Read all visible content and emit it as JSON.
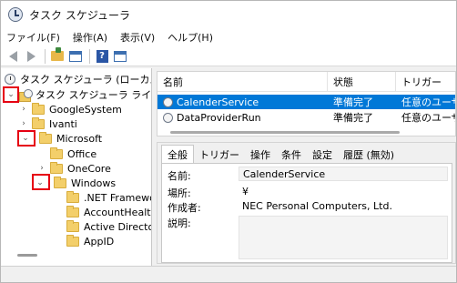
{
  "window": {
    "title": "タスク スケジューラ",
    "icon": "clock-icon"
  },
  "menu": {
    "items": [
      "ファイル(F)",
      "操作(A)",
      "表示(V)",
      "ヘルプ(H)"
    ]
  },
  "toolbar": {
    "icons": [
      "back-arrow-icon",
      "forward-arrow-icon",
      "folder-up-icon",
      "show-hide-tree-icon",
      "help-icon",
      "properties-icon"
    ]
  },
  "tree": {
    "root": "タスク スケジューラ (ローカル)",
    "library": "タスク スケジューラ ライブラリ",
    "items": [
      {
        "label": "GoogleSystem",
        "expanded": false
      },
      {
        "label": "Ivanti",
        "expanded": false
      },
      {
        "label": "Microsoft",
        "expanded": true
      },
      {
        "label": "Office",
        "expanded": false
      },
      {
        "label": "OneCore",
        "expanded": false
      },
      {
        "label": "Windows",
        "expanded": true
      },
      {
        "label": ".NET Framework",
        "expanded": false
      },
      {
        "label": "AccountHealth",
        "expanded": false
      },
      {
        "label": "Active Directory",
        "expanded": false
      },
      {
        "label": "AppID",
        "expanded": false
      }
    ],
    "highlight_color": "#e60012"
  },
  "task_list": {
    "columns": [
      "名前",
      "状態",
      "トリガー"
    ],
    "rows": [
      {
        "name": "CalenderService",
        "status": "準備完了",
        "trigger": "任意のユーザー",
        "selected": true
      },
      {
        "name": "DataProviderRun",
        "status": "準備完了",
        "trigger": "任意のユーザー",
        "selected": false
      }
    ],
    "selection_color": "#0078d7"
  },
  "detail": {
    "tabs": [
      "全般",
      "トリガー",
      "操作",
      "条件",
      "設定",
      "履歴 (無効)"
    ],
    "active_tab": "全般",
    "fields": {
      "name_label": "名前:",
      "name_value": "CalenderService",
      "location_label": "場所:",
      "location_value": "¥",
      "author_label": "作成者:",
      "author_value": "NEC Personal Computers, Ltd.",
      "description_label": "説明:"
    }
  }
}
